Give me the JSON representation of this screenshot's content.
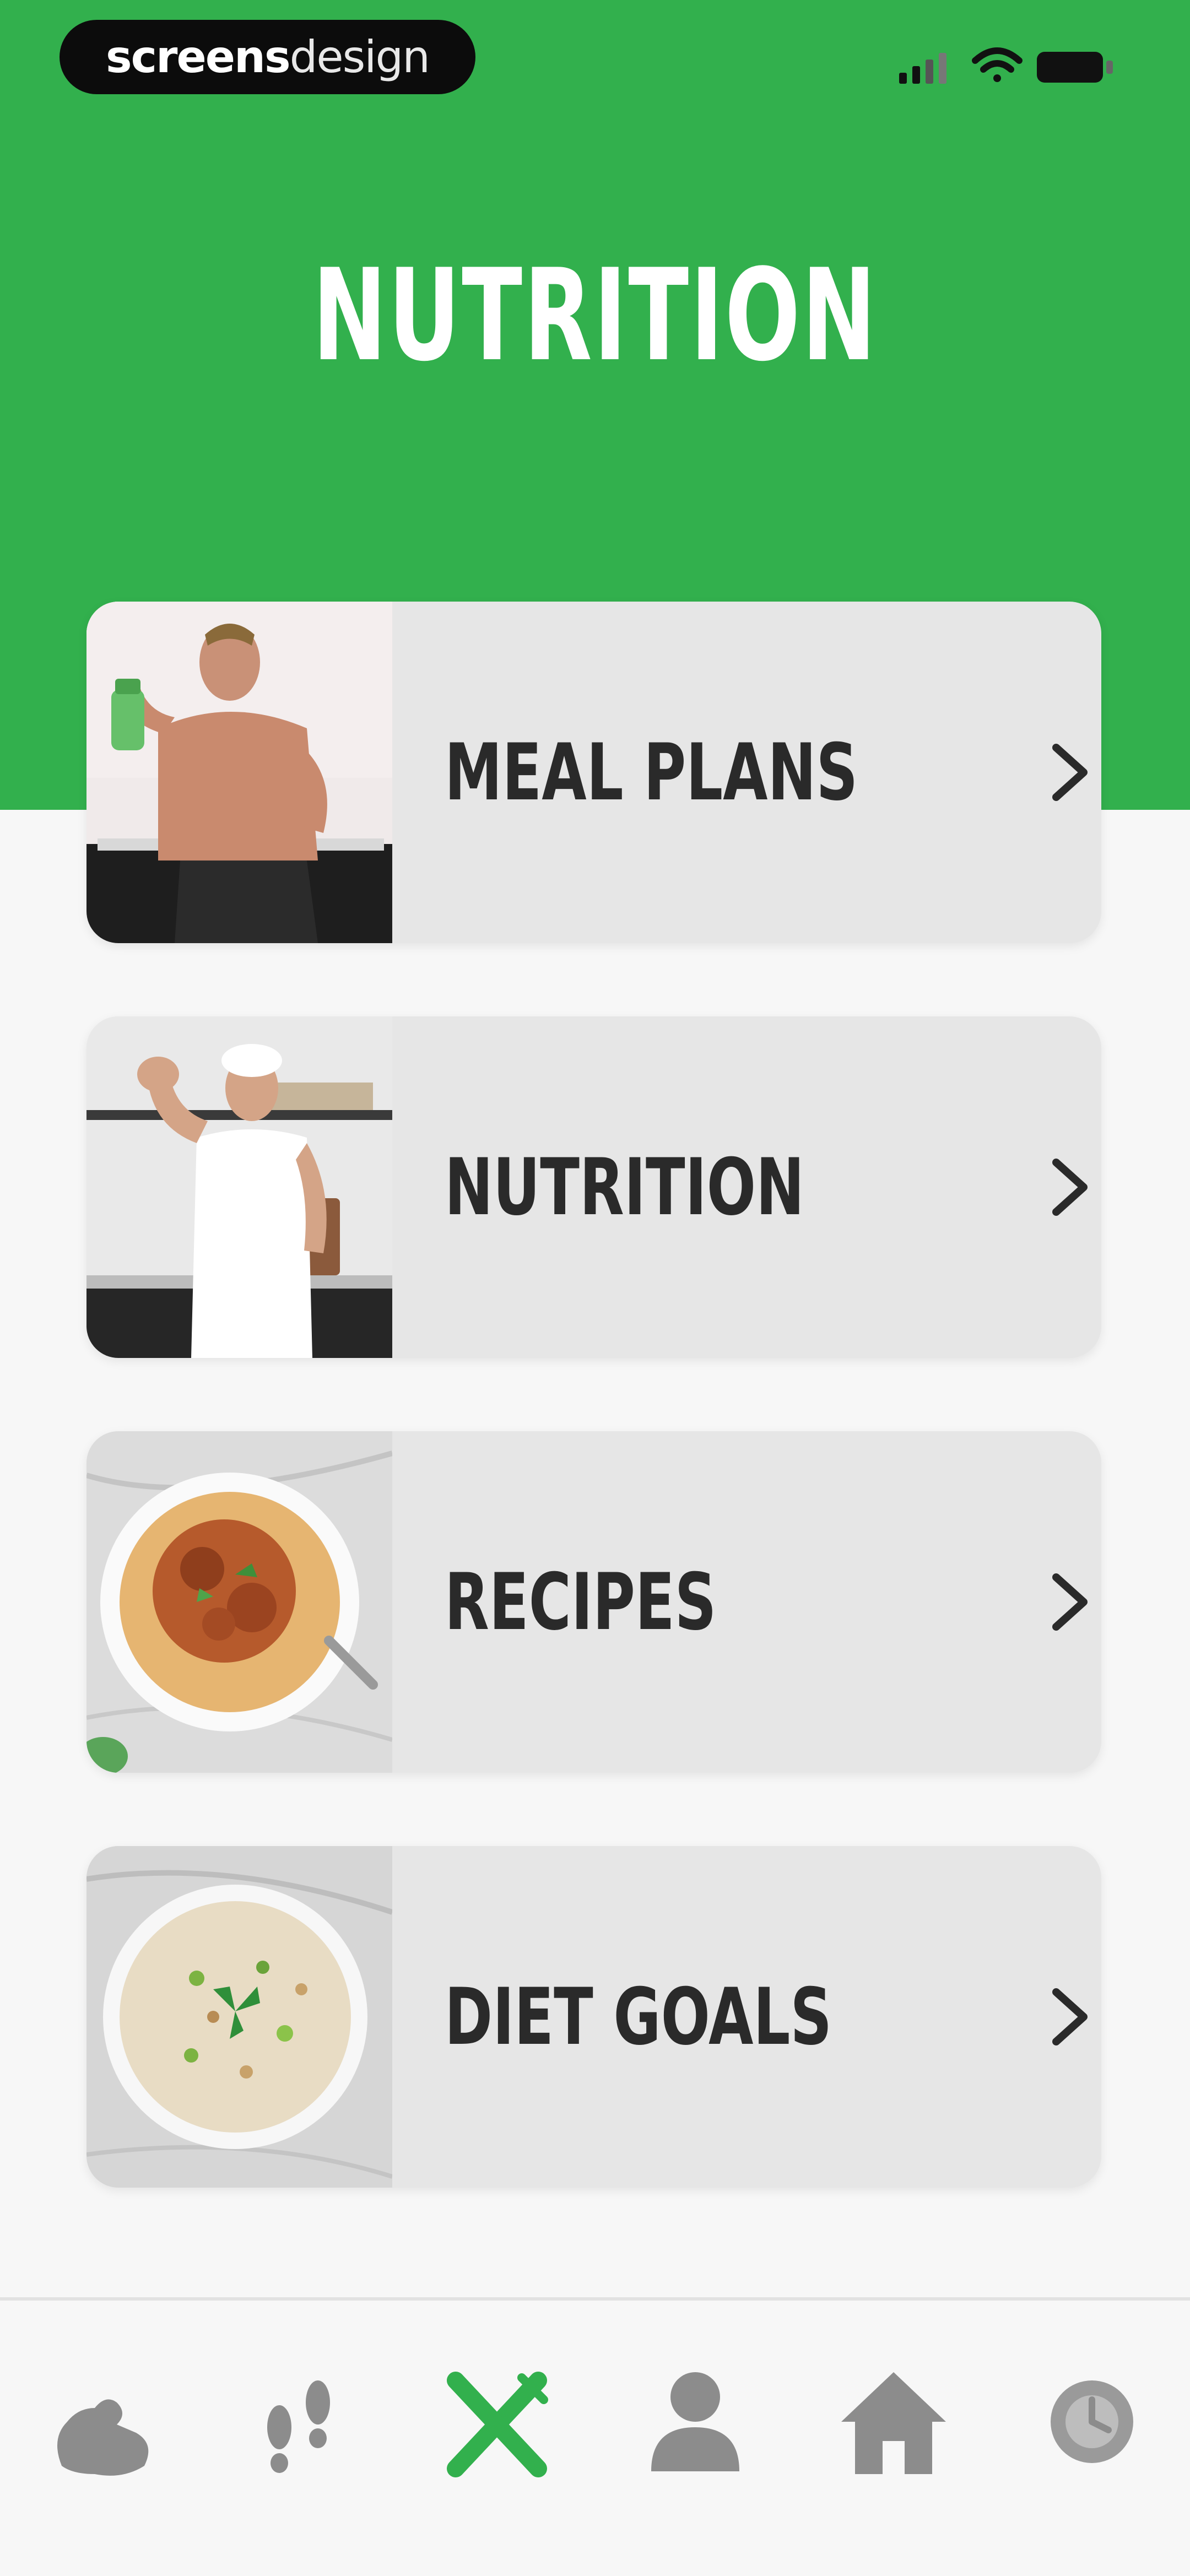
{
  "status_bar": {
    "brand_bold": "screens",
    "brand_light": "design",
    "icons": [
      "signal-icon",
      "wifi-icon",
      "battery-icon"
    ]
  },
  "header": {
    "title": "NUTRITION",
    "bg_color": "#32b04d"
  },
  "menu": {
    "items": [
      {
        "label": "MEAL PLANS",
        "image": "man-holding-shaker-photo"
      },
      {
        "label": "NUTRITION",
        "image": "chef-flexing-photo"
      },
      {
        "label": "RECIPES",
        "image": "pasta-bowl-photo"
      },
      {
        "label": "DIET GOALS",
        "image": "rice-bowl-photo"
      }
    ]
  },
  "bottom_nav": {
    "items": [
      {
        "icon": "arm-muscle-icon",
        "active": false
      },
      {
        "icon": "footsteps-icon",
        "active": false
      },
      {
        "icon": "fork-knife-icon",
        "active": true
      },
      {
        "icon": "person-icon",
        "active": false
      },
      {
        "icon": "home-icon",
        "active": false
      },
      {
        "icon": "clock-icon",
        "active": false
      }
    ],
    "active_color": "#32b04d",
    "inactive_color": "#8c8c8c"
  }
}
